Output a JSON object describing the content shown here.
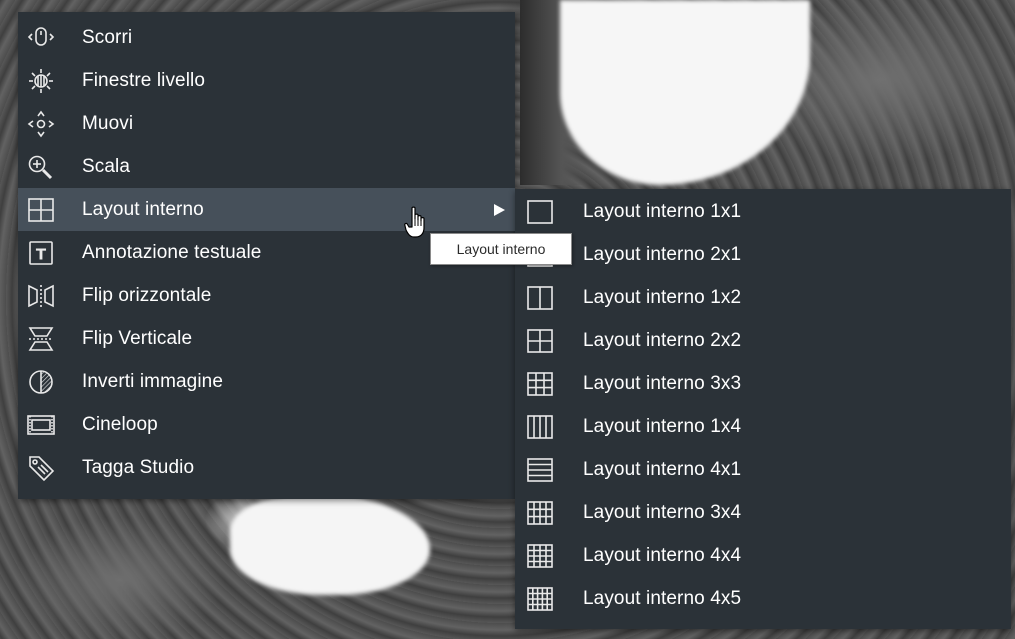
{
  "main_menu": {
    "items": [
      {
        "label": "Scorri",
        "icon": "scroll-mouse-icon"
      },
      {
        "label": "Finestre livello",
        "icon": "window-level-icon"
      },
      {
        "label": "Muovi",
        "icon": "pan-arrows-icon"
      },
      {
        "label": "Scala",
        "icon": "zoom-magnifier-icon"
      },
      {
        "label": "Layout interno",
        "icon": "grid-2x2-icon",
        "active": true,
        "has_submenu": true
      },
      {
        "label": "Annotazione testuale",
        "icon": "text-annotation-icon"
      },
      {
        "label": "Flip orizzontale",
        "icon": "flip-horizontal-icon"
      },
      {
        "label": "Flip Verticale",
        "icon": "flip-vertical-icon"
      },
      {
        "label": "Inverti immagine",
        "icon": "invert-image-icon"
      },
      {
        "label": "Cineloop",
        "icon": "film-strip-icon"
      },
      {
        "label": "Tagga Studio",
        "icon": "tag-icon"
      }
    ]
  },
  "sub_menu": {
    "items": [
      {
        "label": "Layout interno 1x1",
        "icon": "layout-1x1-icon"
      },
      {
        "label": "Layout interno 2x1",
        "icon": "layout-2x1-icon"
      },
      {
        "label": "Layout interno 1x2",
        "icon": "layout-1x2-icon"
      },
      {
        "label": "Layout interno 2x2",
        "icon": "layout-2x2-icon"
      },
      {
        "label": "Layout interno 3x3",
        "icon": "layout-3x3-icon"
      },
      {
        "label": "Layout interno 1x4",
        "icon": "layout-1x4-icon"
      },
      {
        "label": "Layout interno 4x1",
        "icon": "layout-4x1-icon"
      },
      {
        "label": "Layout interno 3x4",
        "icon": "layout-3x4-icon"
      },
      {
        "label": "Layout interno 4x4",
        "icon": "layout-4x4-icon"
      },
      {
        "label": "Layout interno 4x5",
        "icon": "layout-4x5-icon"
      }
    ]
  },
  "tooltip": {
    "text": "Layout interno"
  },
  "colors": {
    "menu_bg": "#2b3238",
    "menu_active": "#46505a",
    "menu_text": "#ffffff",
    "tooltip_bg": "#ffffff"
  }
}
